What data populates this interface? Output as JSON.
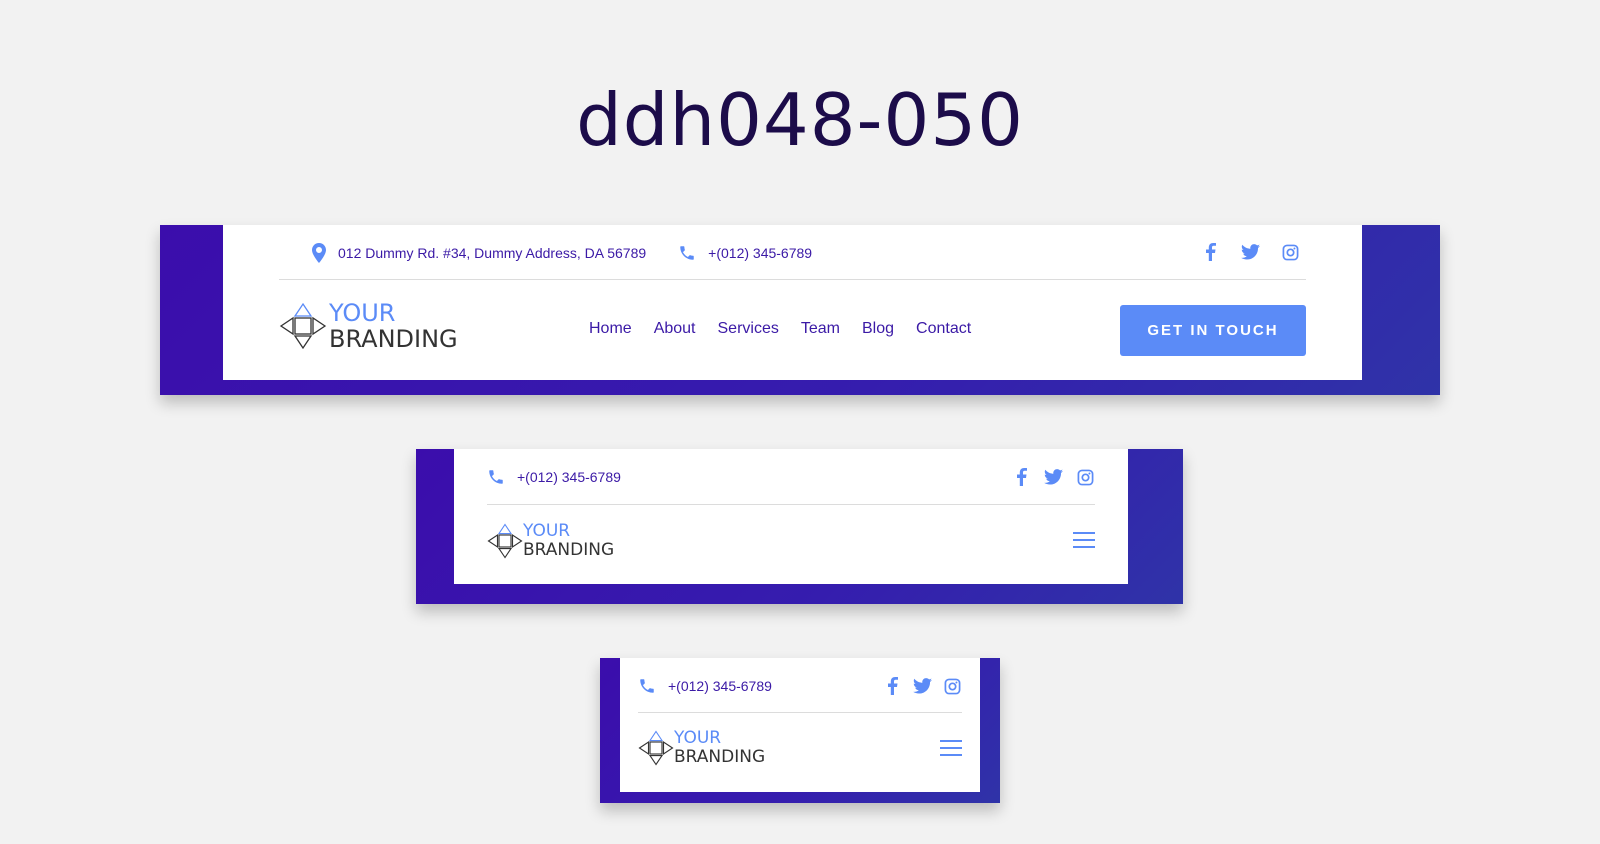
{
  "page_title": "ddh048-050",
  "topbar": {
    "address": "012 Dummy Rd. #34, Dummy Address, DA 56789",
    "phone": "+(012) 345-6789"
  },
  "brand": {
    "line1": "YOUR",
    "line2": "BRANDING"
  },
  "nav": {
    "items": [
      "Home",
      "About",
      "Services",
      "Team",
      "Blog",
      "Contact"
    ]
  },
  "cta_label": "GET IN TOUCH",
  "icons": {
    "location": "map-pin-icon",
    "phone": "phone-icon",
    "facebook": "facebook-icon",
    "twitter": "twitter-icon",
    "instagram": "instagram-icon",
    "menu": "hamburger-menu-icon"
  },
  "colors": {
    "frame": "#3b0dac",
    "accent": "#5b8bf7",
    "text": "#3b1aa6",
    "title": "#1c0c4a"
  }
}
